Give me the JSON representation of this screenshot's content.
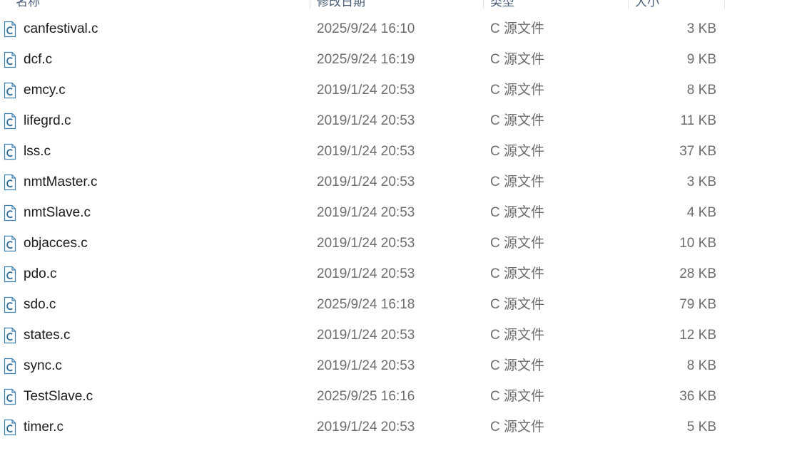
{
  "columns": {
    "name": "名称",
    "modified": "修改日期",
    "type": "类型",
    "size": "大小"
  },
  "files": [
    {
      "name": "canfestival.c",
      "modified": "2025/9/24 16:10",
      "type": "C 源文件",
      "size": "3 KB",
      "icon": "c-source-file-icon"
    },
    {
      "name": "dcf.c",
      "modified": "2025/9/24 16:19",
      "type": "C 源文件",
      "size": "9 KB",
      "icon": "c-source-file-icon"
    },
    {
      "name": "emcy.c",
      "modified": "2019/1/24 20:53",
      "type": "C 源文件",
      "size": "8 KB",
      "icon": "c-source-file-icon"
    },
    {
      "name": "lifegrd.c",
      "modified": "2019/1/24 20:53",
      "type": "C 源文件",
      "size": "11 KB",
      "icon": "c-source-file-icon"
    },
    {
      "name": "lss.c",
      "modified": "2019/1/24 20:53",
      "type": "C 源文件",
      "size": "37 KB",
      "icon": "c-source-file-icon"
    },
    {
      "name": "nmtMaster.c",
      "modified": "2019/1/24 20:53",
      "type": "C 源文件",
      "size": "3 KB",
      "icon": "c-source-file-icon"
    },
    {
      "name": "nmtSlave.c",
      "modified": "2019/1/24 20:53",
      "type": "C 源文件",
      "size": "4 KB",
      "icon": "c-source-file-icon"
    },
    {
      "name": "objacces.c",
      "modified": "2019/1/24 20:53",
      "type": "C 源文件",
      "size": "10 KB",
      "icon": "c-source-file-icon"
    },
    {
      "name": "pdo.c",
      "modified": "2019/1/24 20:53",
      "type": "C 源文件",
      "size": "28 KB",
      "icon": "c-source-file-icon"
    },
    {
      "name": "sdo.c",
      "modified": "2025/9/24 16:18",
      "type": "C 源文件",
      "size": "79 KB",
      "icon": "c-source-file-icon"
    },
    {
      "name": "states.c",
      "modified": "2019/1/24 20:53",
      "type": "C 源文件",
      "size": "12 KB",
      "icon": "c-source-file-icon"
    },
    {
      "name": "sync.c",
      "modified": "2019/1/24 20:53",
      "type": "C 源文件",
      "size": "8 KB",
      "icon": "c-source-file-icon"
    },
    {
      "name": "TestSlave.c",
      "modified": "2025/9/25 16:16",
      "type": "C 源文件",
      "size": "36 KB",
      "icon": "c-source-file-icon"
    },
    {
      "name": "timer.c",
      "modified": "2019/1/24 20:53",
      "type": "C 源文件",
      "size": "5 KB",
      "icon": "c-source-file-icon"
    }
  ],
  "colors": {
    "icon_outline": "#3c7fb1",
    "icon_letter": "#2b6a9a",
    "name_text": "#1b1b1b",
    "detail_text": "#6d6d6d"
  }
}
